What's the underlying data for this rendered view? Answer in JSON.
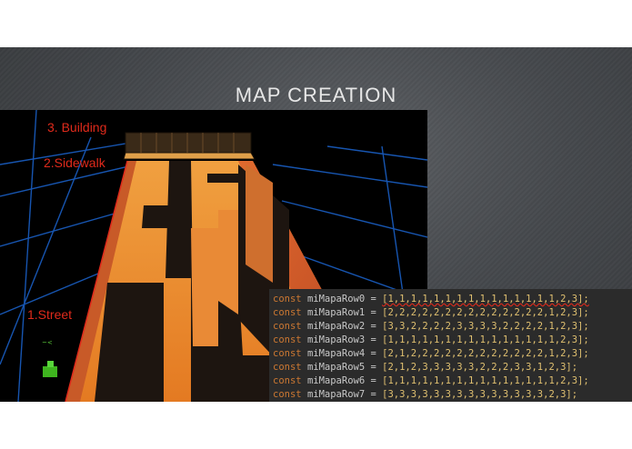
{
  "slide": {
    "title": "MAP CREATION"
  },
  "labels": {
    "building": "3. Building",
    "sidewalk": "2.Sidewalk",
    "street": "1.Street"
  },
  "code": {
    "keyword": "const",
    "rows": [
      {
        "name": "miMapaRow0",
        "values": "[1,1,1,1,1,1,1,1,1,1,1,1,1,1,1,2,3];"
      },
      {
        "name": "miMapaRow1",
        "values": "[2,2,2,2,2,2,2,2,2,2,2,2,2,2,1,2,3];"
      },
      {
        "name": "miMapaRow2",
        "values": "[3,3,2,2,2,2,3,3,3,3,2,2,2,2,1,2,3];"
      },
      {
        "name": "miMapaRow3",
        "values": "[1,1,1,1,1,1,1,1,1,1,1,1,1,1,1,2,3];"
      },
      {
        "name": "miMapaRow4",
        "values": "[2,1,2,2,2,2,2,2,2,2,2,2,2,2,1,2,3];"
      },
      {
        "name": "miMapaRow5",
        "values": "[2,1,2,3,3,3,3,3,2,2,2,3,3,1,2,3];"
      },
      {
        "name": "miMapaRow6",
        "values": "[1,1,1,1,1,1,1,1,1,1,1,1,1,1,1,2,3];"
      },
      {
        "name": "miMapaRow7",
        "values": "[3,3,3,3,3,3,3,3,3,3,3,3,3,3,2,3];"
      }
    ]
  },
  "toolbar": {
    "icons": [
      "prev-icon",
      "next-icon",
      "pen-icon",
      "slides-icon",
      "zoom-icon",
      "more-icon"
    ],
    "glyphs": [
      "◀",
      "▶",
      "✎",
      "▦",
      "⌕",
      "•••"
    ]
  },
  "colors": {
    "street": "#f0862a",
    "sidewalk": "#c8632a",
    "building": "#2a1f14",
    "grid": "#1e6fd0",
    "label": "#e02a1b"
  }
}
